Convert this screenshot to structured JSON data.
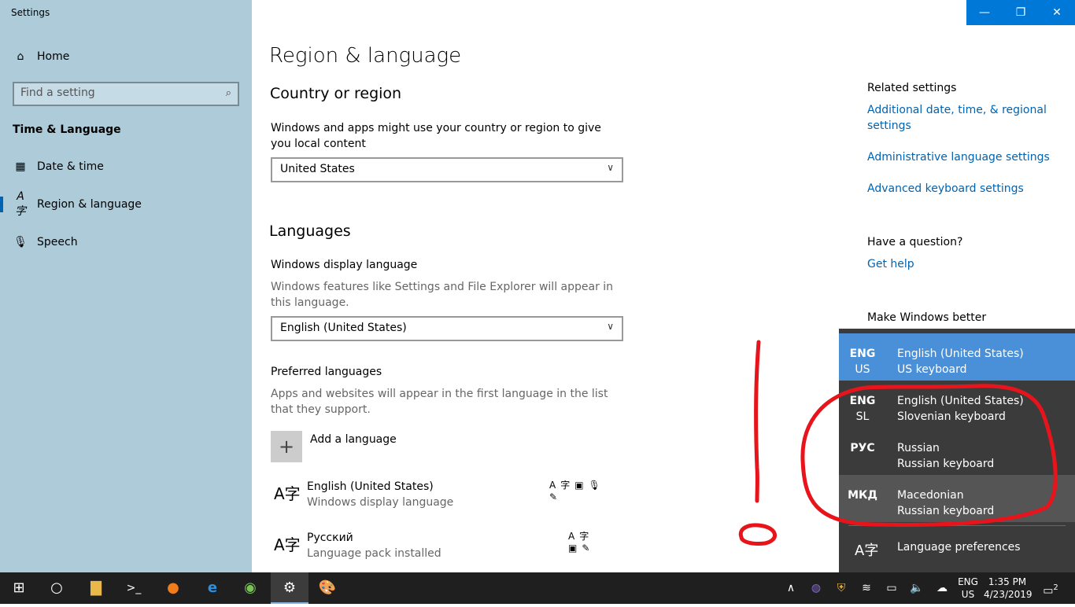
{
  "window": {
    "title": "Settings"
  },
  "sidebar": {
    "home_label": "Home",
    "search_placeholder": "Find a setting",
    "section_title": "Time & Language",
    "items": [
      {
        "label": "Date & time",
        "icon": "calendar-clock-icon"
      },
      {
        "label": "Region & language",
        "icon": "language-icon"
      },
      {
        "label": "Speech",
        "icon": "microphone-icon"
      }
    ]
  },
  "main": {
    "page_title": "Region & language",
    "country": {
      "heading": "Country or region",
      "description": "Windows and apps might use your country or region to give you local content",
      "value": "United States"
    },
    "languages": {
      "heading": "Languages",
      "display_label": "Windows display language",
      "display_description": "Windows features like Settings and File Explorer will appear in this language.",
      "display_value": "English (United States)",
      "preferred_label": "Preferred languages",
      "preferred_description": "Apps and websites will appear in the first language in the list that they support.",
      "add_label": "Add a language",
      "list": [
        {
          "name": "English (United States)",
          "status": "Windows display language"
        },
        {
          "name": "Русский",
          "status": "Language pack installed"
        }
      ]
    }
  },
  "related": {
    "heading": "Related settings",
    "links": [
      "Additional date, time, & regional settings",
      "Administrative language settings",
      "Advanced keyboard settings"
    ],
    "question_heading": "Have a question?",
    "help_link": "Get help",
    "better_heading": "Make Windows better"
  },
  "flyout": {
    "items": [
      {
        "code": "ENG",
        "sub": "US",
        "name": "English (United States)",
        "keyboard": "US keyboard",
        "state": "selected"
      },
      {
        "code": "ENG",
        "sub": "SL",
        "name": "English (United States)",
        "keyboard": "Slovenian keyboard",
        "state": "normal"
      },
      {
        "code": "РУС",
        "sub": "",
        "name": "Russian",
        "keyboard": "Russian keyboard",
        "state": "normal"
      },
      {
        "code": "МКД",
        "sub": "",
        "name": "Macedonian",
        "keyboard": "Russian keyboard",
        "state": "hover"
      }
    ],
    "preferences_label": "Language preferences"
  },
  "taskbar": {
    "lang_code": "ENG",
    "lang_sub": "US",
    "time": "1:35 PM",
    "date": "4/23/2019",
    "notification_count": "2"
  },
  "colors": {
    "accent": "#0078d7",
    "sidebar": "#aecbd9",
    "link": "#0063b1",
    "flyout_selected": "#4a90d9",
    "annotation": "#e8141c"
  }
}
